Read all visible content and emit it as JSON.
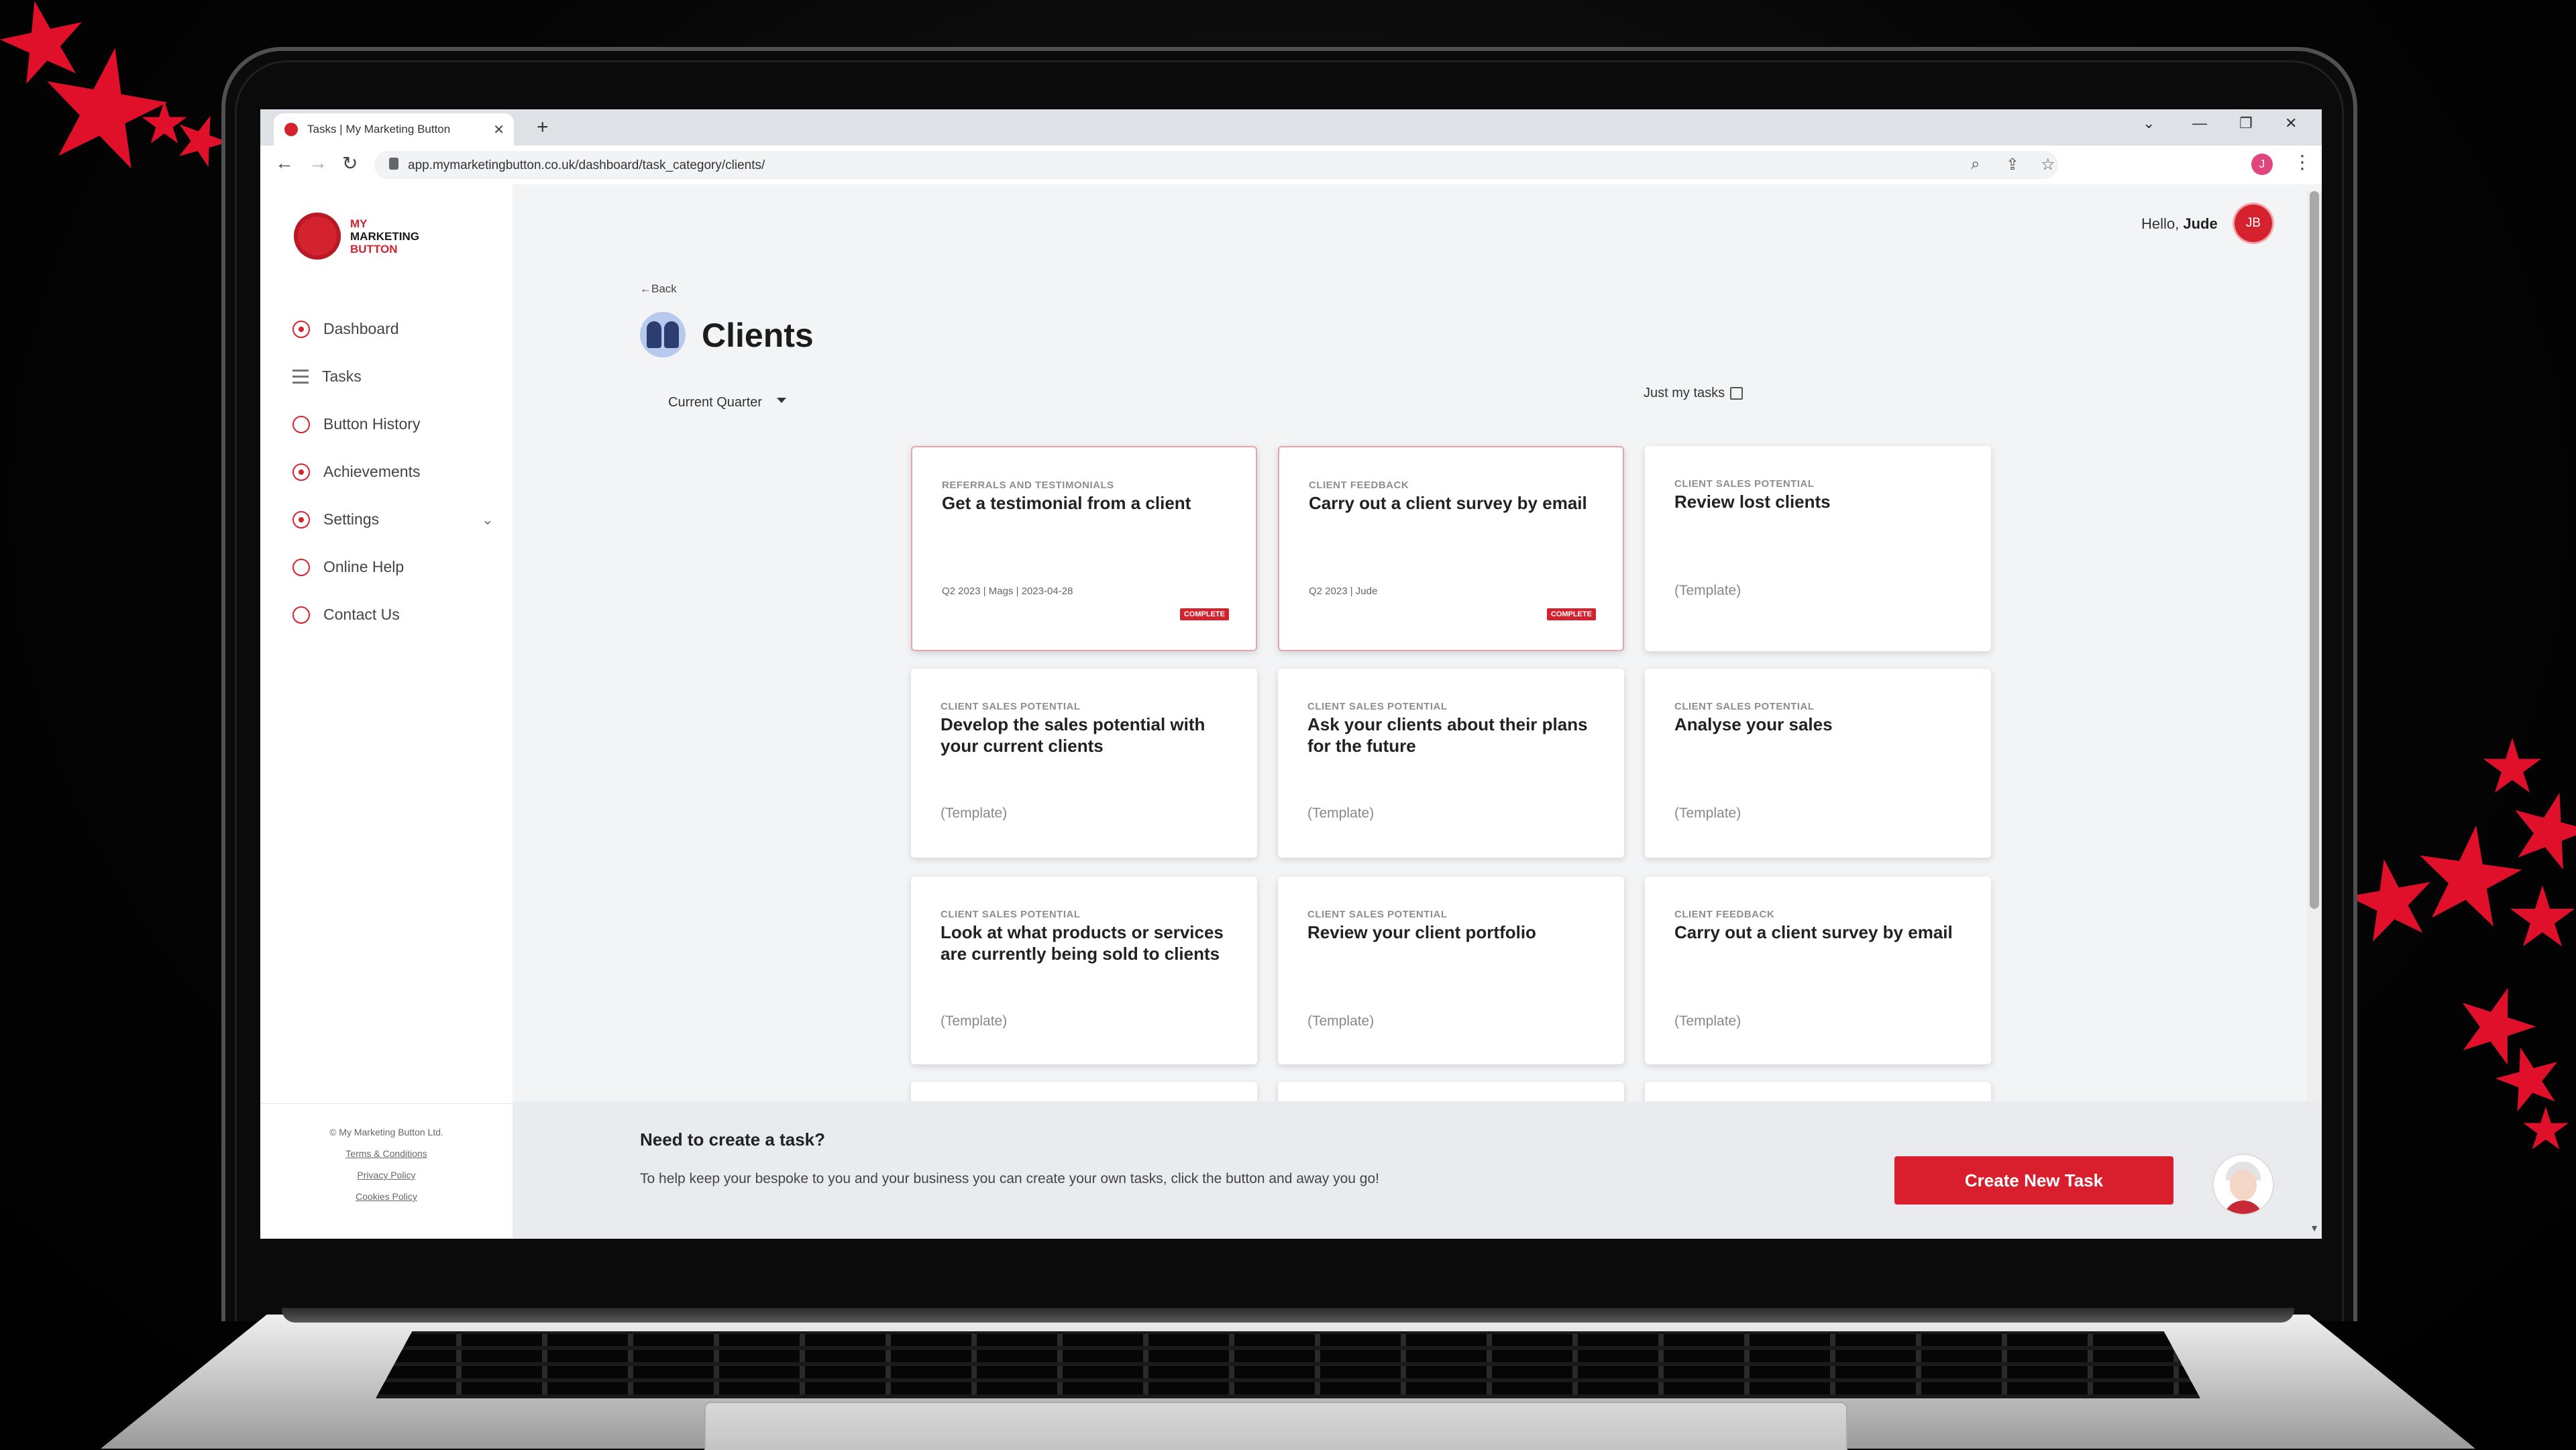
{
  "browser": {
    "tab_title": "Tasks | My Marketing Button",
    "url": "app.mymarketingbutton.co.uk/dashboard/task_category/clients/",
    "profile_initial": "J"
  },
  "brand": {
    "line1": "MY",
    "line2": "MARKETING",
    "line3": "BUTTON",
    "accent": "#d4232f"
  },
  "sidebar": {
    "items": [
      {
        "label": "Dashboard"
      },
      {
        "label": "Tasks"
      },
      {
        "label": "Button History"
      },
      {
        "label": "Achievements"
      },
      {
        "label": "Settings"
      },
      {
        "label": "Online Help"
      },
      {
        "label": "Contact Us"
      }
    ],
    "footer": {
      "copyright": "© My Marketing Button Ltd.",
      "terms": "Terms & Conditions",
      "privacy": "Privacy Policy",
      "cookies": "Cookies Policy"
    }
  },
  "header": {
    "greeting": "Hello,",
    "name": "Jude",
    "avatar_initials": "JB"
  },
  "page": {
    "back_label": "Back",
    "title": "Clients",
    "filter_label": "Current Quarter",
    "just_my_tasks_label": "Just my tasks"
  },
  "cards": [
    {
      "category": "REFERRALS AND TESTIMONIALS",
      "title": "Get a testimonial from a client",
      "meta": "Q2 2023  |  Mags  |  2023-04-28",
      "badge": "COMPLETE"
    },
    {
      "category": "CLIENT FEEDBACK",
      "title": "Carry out a client survey by email",
      "meta": "Q2 2023  |  Jude",
      "badge": "COMPLETE"
    },
    {
      "category": "CLIENT SALES POTENTIAL",
      "title": "Review lost clients",
      "template": "(Template)"
    },
    {
      "category": "CLIENT SALES POTENTIAL",
      "title": "Develop the sales potential with your current clients",
      "template": "(Template)"
    },
    {
      "category": "CLIENT SALES POTENTIAL",
      "title": "Ask your clients about their plans for the future",
      "template": "(Template)"
    },
    {
      "category": "CLIENT SALES POTENTIAL",
      "title": "Analyse your sales",
      "template": "(Template)"
    },
    {
      "category": "CLIENT SALES POTENTIAL",
      "title": "Look at what products or services are currently being sold to clients",
      "template": "(Template)"
    },
    {
      "category": "CLIENT SALES POTENTIAL",
      "title": "Review your client portfolio",
      "template": "(Template)"
    },
    {
      "category": "CLIENT FEEDBACK",
      "title": "Carry out a client survey by email",
      "template": "(Template)"
    }
  ],
  "footer": {
    "title": "Need to create a task?",
    "text": "To help keep your bespoke to you and your business you can create your own tasks, click the button and away you go!",
    "button": "Create New Task"
  }
}
